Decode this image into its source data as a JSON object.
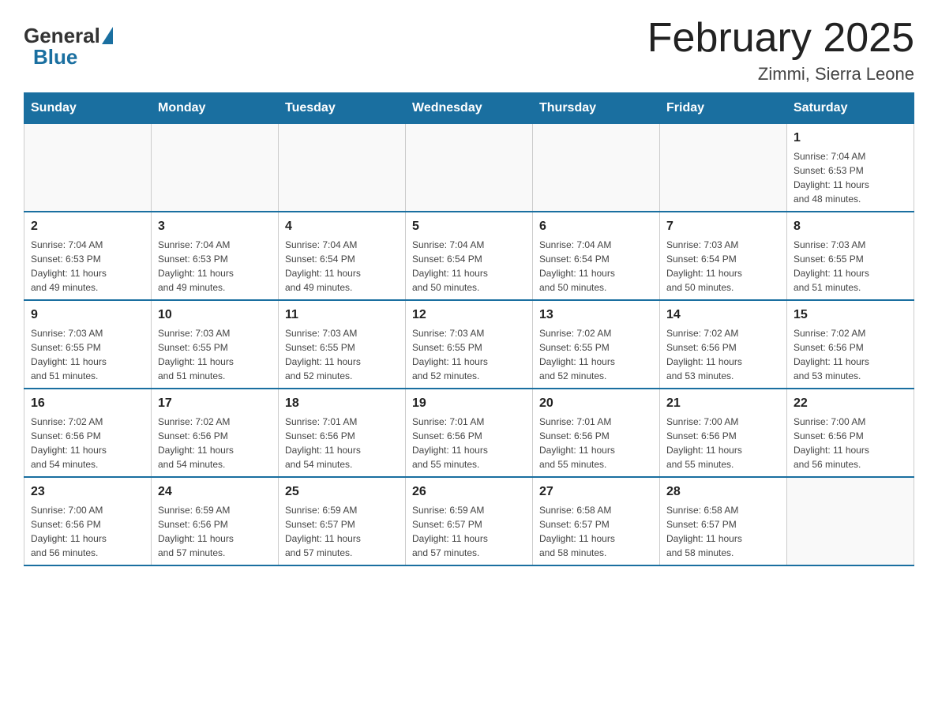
{
  "header": {
    "logo_general": "General",
    "logo_blue": "Blue",
    "title": "February 2025",
    "subtitle": "Zimmi, Sierra Leone"
  },
  "days_of_week": [
    "Sunday",
    "Monday",
    "Tuesday",
    "Wednesday",
    "Thursday",
    "Friday",
    "Saturday"
  ],
  "weeks": [
    [
      {
        "day": "",
        "info": ""
      },
      {
        "day": "",
        "info": ""
      },
      {
        "day": "",
        "info": ""
      },
      {
        "day": "",
        "info": ""
      },
      {
        "day": "",
        "info": ""
      },
      {
        "day": "",
        "info": ""
      },
      {
        "day": "1",
        "info": "Sunrise: 7:04 AM\nSunset: 6:53 PM\nDaylight: 11 hours\nand 48 minutes."
      }
    ],
    [
      {
        "day": "2",
        "info": "Sunrise: 7:04 AM\nSunset: 6:53 PM\nDaylight: 11 hours\nand 49 minutes."
      },
      {
        "day": "3",
        "info": "Sunrise: 7:04 AM\nSunset: 6:53 PM\nDaylight: 11 hours\nand 49 minutes."
      },
      {
        "day": "4",
        "info": "Sunrise: 7:04 AM\nSunset: 6:54 PM\nDaylight: 11 hours\nand 49 minutes."
      },
      {
        "day": "5",
        "info": "Sunrise: 7:04 AM\nSunset: 6:54 PM\nDaylight: 11 hours\nand 50 minutes."
      },
      {
        "day": "6",
        "info": "Sunrise: 7:04 AM\nSunset: 6:54 PM\nDaylight: 11 hours\nand 50 minutes."
      },
      {
        "day": "7",
        "info": "Sunrise: 7:03 AM\nSunset: 6:54 PM\nDaylight: 11 hours\nand 50 minutes."
      },
      {
        "day": "8",
        "info": "Sunrise: 7:03 AM\nSunset: 6:55 PM\nDaylight: 11 hours\nand 51 minutes."
      }
    ],
    [
      {
        "day": "9",
        "info": "Sunrise: 7:03 AM\nSunset: 6:55 PM\nDaylight: 11 hours\nand 51 minutes."
      },
      {
        "day": "10",
        "info": "Sunrise: 7:03 AM\nSunset: 6:55 PM\nDaylight: 11 hours\nand 51 minutes."
      },
      {
        "day": "11",
        "info": "Sunrise: 7:03 AM\nSunset: 6:55 PM\nDaylight: 11 hours\nand 52 minutes."
      },
      {
        "day": "12",
        "info": "Sunrise: 7:03 AM\nSunset: 6:55 PM\nDaylight: 11 hours\nand 52 minutes."
      },
      {
        "day": "13",
        "info": "Sunrise: 7:02 AM\nSunset: 6:55 PM\nDaylight: 11 hours\nand 52 minutes."
      },
      {
        "day": "14",
        "info": "Sunrise: 7:02 AM\nSunset: 6:56 PM\nDaylight: 11 hours\nand 53 minutes."
      },
      {
        "day": "15",
        "info": "Sunrise: 7:02 AM\nSunset: 6:56 PM\nDaylight: 11 hours\nand 53 minutes."
      }
    ],
    [
      {
        "day": "16",
        "info": "Sunrise: 7:02 AM\nSunset: 6:56 PM\nDaylight: 11 hours\nand 54 minutes."
      },
      {
        "day": "17",
        "info": "Sunrise: 7:02 AM\nSunset: 6:56 PM\nDaylight: 11 hours\nand 54 minutes."
      },
      {
        "day": "18",
        "info": "Sunrise: 7:01 AM\nSunset: 6:56 PM\nDaylight: 11 hours\nand 54 minutes."
      },
      {
        "day": "19",
        "info": "Sunrise: 7:01 AM\nSunset: 6:56 PM\nDaylight: 11 hours\nand 55 minutes."
      },
      {
        "day": "20",
        "info": "Sunrise: 7:01 AM\nSunset: 6:56 PM\nDaylight: 11 hours\nand 55 minutes."
      },
      {
        "day": "21",
        "info": "Sunrise: 7:00 AM\nSunset: 6:56 PM\nDaylight: 11 hours\nand 55 minutes."
      },
      {
        "day": "22",
        "info": "Sunrise: 7:00 AM\nSunset: 6:56 PM\nDaylight: 11 hours\nand 56 minutes."
      }
    ],
    [
      {
        "day": "23",
        "info": "Sunrise: 7:00 AM\nSunset: 6:56 PM\nDaylight: 11 hours\nand 56 minutes."
      },
      {
        "day": "24",
        "info": "Sunrise: 6:59 AM\nSunset: 6:56 PM\nDaylight: 11 hours\nand 57 minutes."
      },
      {
        "day": "25",
        "info": "Sunrise: 6:59 AM\nSunset: 6:57 PM\nDaylight: 11 hours\nand 57 minutes."
      },
      {
        "day": "26",
        "info": "Sunrise: 6:59 AM\nSunset: 6:57 PM\nDaylight: 11 hours\nand 57 minutes."
      },
      {
        "day": "27",
        "info": "Sunrise: 6:58 AM\nSunset: 6:57 PM\nDaylight: 11 hours\nand 58 minutes."
      },
      {
        "day": "28",
        "info": "Sunrise: 6:58 AM\nSunset: 6:57 PM\nDaylight: 11 hours\nand 58 minutes."
      },
      {
        "day": "",
        "info": ""
      }
    ]
  ]
}
